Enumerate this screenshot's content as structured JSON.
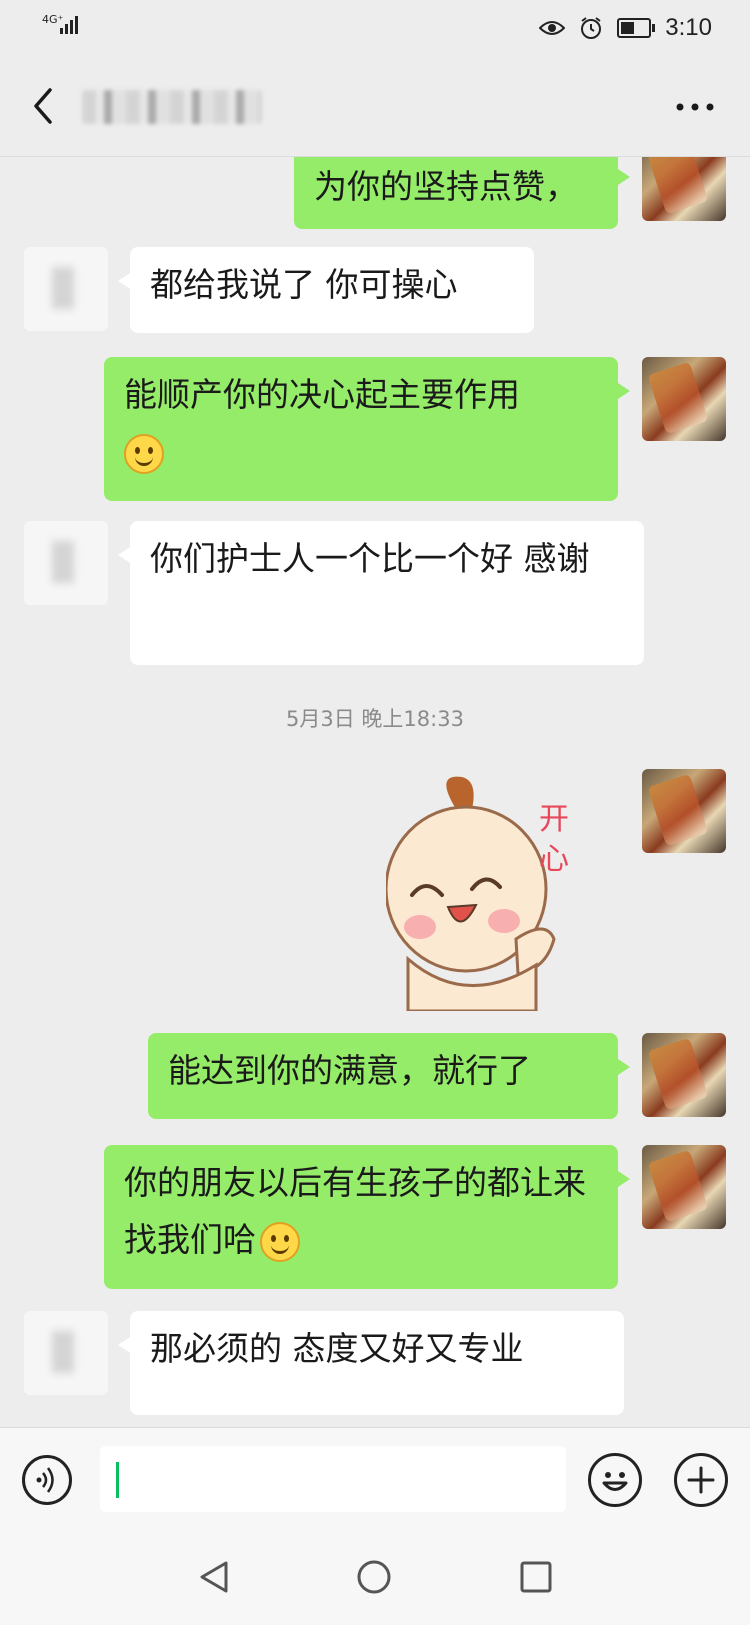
{
  "status_bar": {
    "network": "4G⁺",
    "time": "3:10"
  },
  "chat": {
    "contact_name": "",
    "messages": [
      {
        "sender": "me",
        "text": "为你的坚持点赞，"
      },
      {
        "sender": "other",
        "text": "都给我说了 你可操心"
      },
      {
        "sender": "me",
        "text": "能顺产你的决心起主要作用",
        "emoji": "smile-emoji"
      },
      {
        "sender": "other",
        "text": "你们护士人一个比一个好 感谢"
      },
      {
        "sender": "me",
        "sticker": "baby-happy-sticker",
        "sticker_text": "开心"
      },
      {
        "sender": "me",
        "text": "能达到你的满意，就行了"
      },
      {
        "sender": "me",
        "text": "你的朋友以后有生孩子的都让来找我们哈",
        "emoji": "blush-emoji"
      },
      {
        "sender": "other",
        "text": "那必须的 态度又好又专业"
      }
    ],
    "timestamp": "5月3日 晚上18:33"
  },
  "icons": {
    "back": "back-chevron-icon",
    "more": "more-dots-icon",
    "voice": "voice-icon",
    "emoji": "emoji-icon",
    "plus": "plus-icon",
    "nav_back": "nav-back-icon",
    "nav_home": "nav-home-icon",
    "nav_recent": "nav-recent-icon"
  },
  "colors": {
    "my_bubble": "#95ec69",
    "other_bubble": "#ffffff",
    "background": "#ededed",
    "caret": "#07c160"
  }
}
